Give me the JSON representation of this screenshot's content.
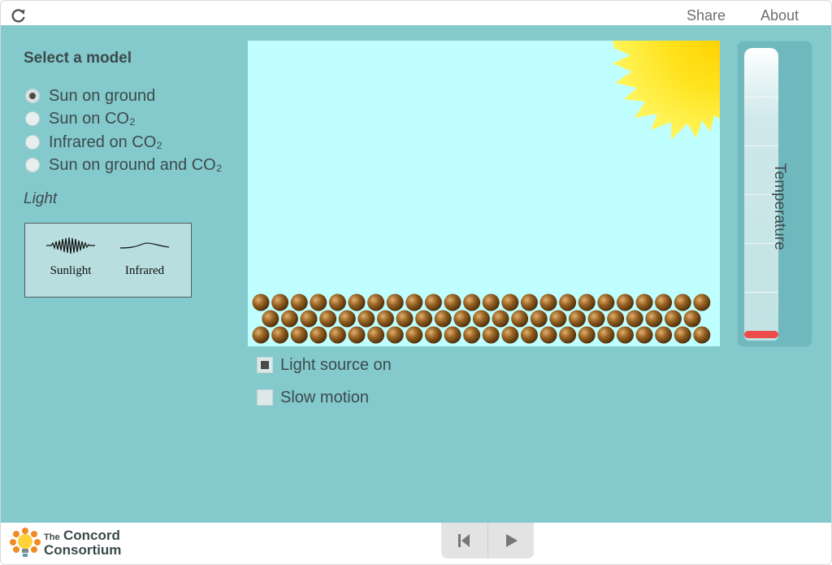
{
  "header": {
    "reload_icon": "reload-icon",
    "share_label": "Share",
    "about_label": "About"
  },
  "model_panel": {
    "title": "Select a model",
    "options": [
      {
        "label": "Sun on ground",
        "selected": true
      },
      {
        "label": "Sun on CO₂",
        "selected": false
      },
      {
        "label": "Infrared on CO₂",
        "selected": false
      },
      {
        "label": "Sun on ground and CO₂",
        "selected": false
      }
    ]
  },
  "light_legend": {
    "heading": "Light",
    "sunlight_label": "Sunlight",
    "infrared_label": "Infrared"
  },
  "simulation": {
    "sun_icon": "sun-icon",
    "ground_rows": 3,
    "colors": {
      "sky": "#bfffff",
      "sun": "#ffe21a",
      "ground": "#8a5a1e"
    }
  },
  "thermometer": {
    "label": "Temperature",
    "level": 0.03,
    "fill_color": "#ee4b4b"
  },
  "controls": {
    "light_source_label": "Light source on",
    "light_source_checked": true,
    "slow_motion_label": "Slow motion",
    "slow_motion_checked": false
  },
  "footer": {
    "logo_line1": "The",
    "logo_line1b": "Concord",
    "logo_line2": "Consortium",
    "reset_icon": "step-back-icon",
    "play_icon": "play-icon"
  },
  "theme": {
    "main_bg": "#84cacd",
    "text": "#3d4a4b"
  }
}
